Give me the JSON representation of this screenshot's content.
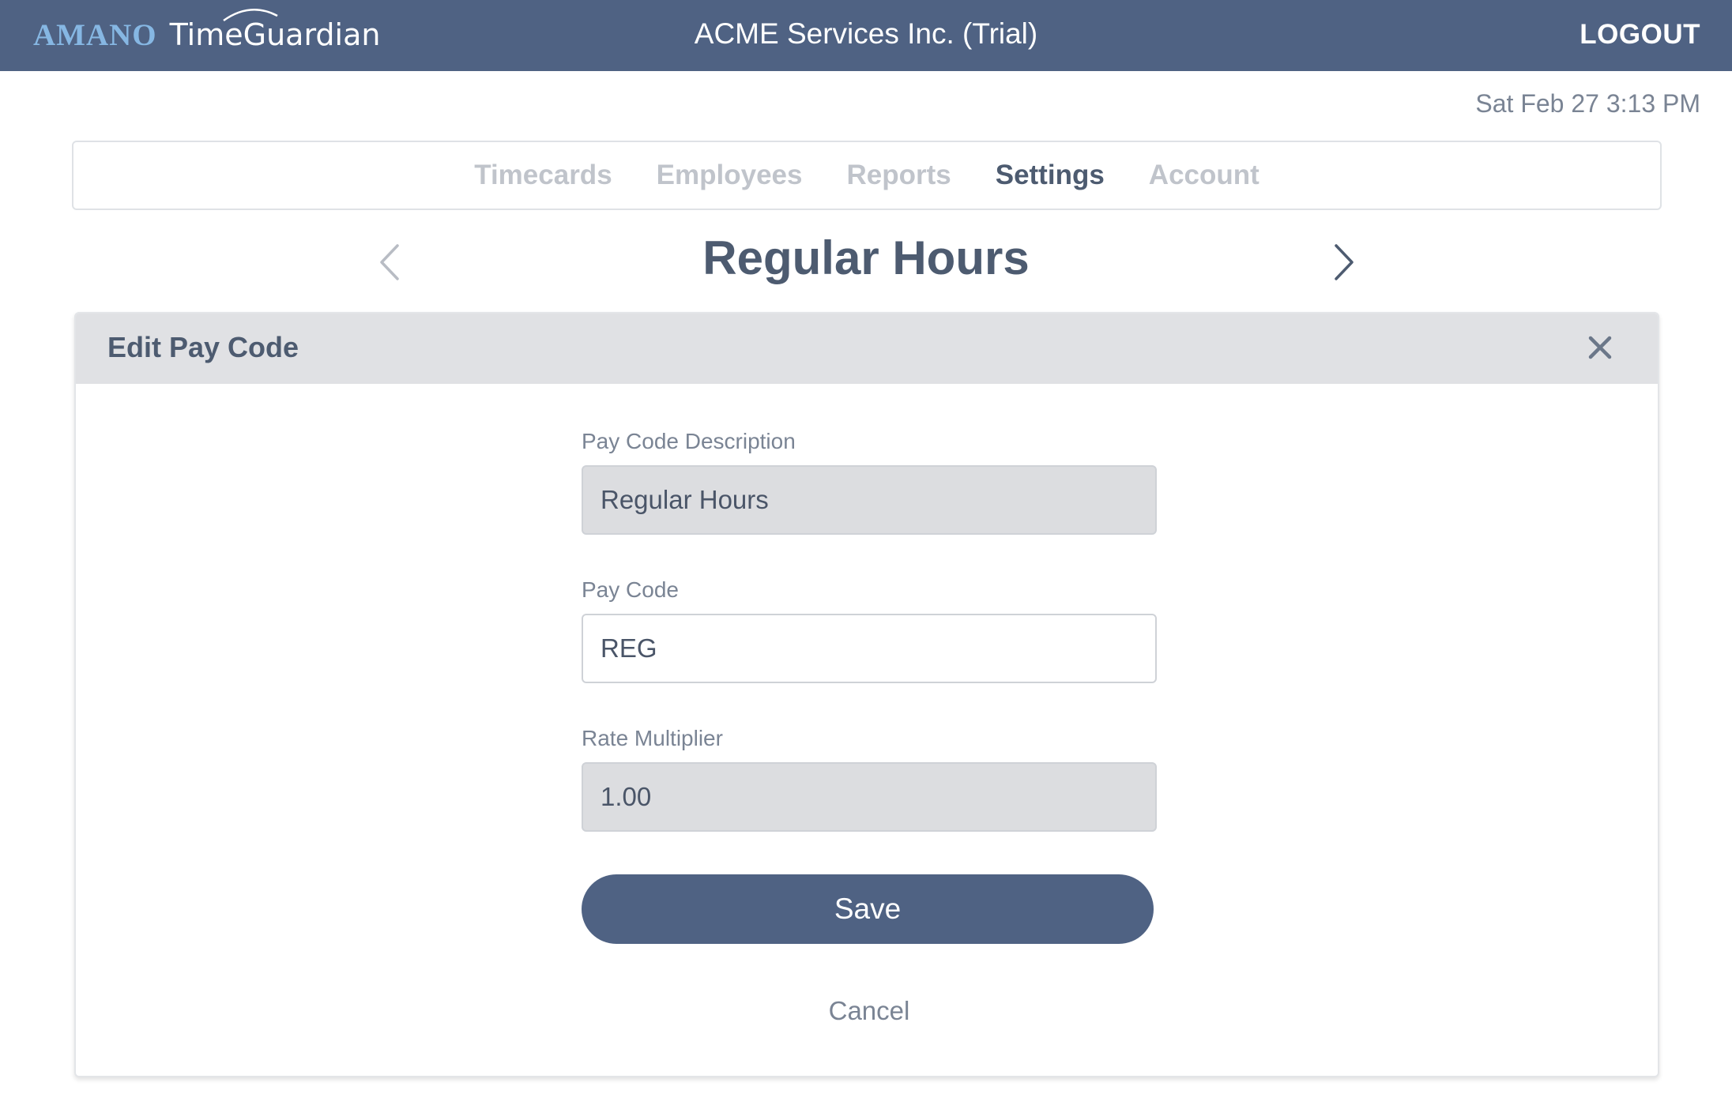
{
  "header": {
    "brand_amano": "AMANO",
    "brand_product": "TimeGuardian",
    "company": "ACME Services Inc. (Trial)",
    "logout_label": "LOGOUT"
  },
  "datetime": "Sat Feb 27 3:13 PM",
  "nav": {
    "tabs": [
      {
        "label": "Timecards",
        "active": false
      },
      {
        "label": "Employees",
        "active": false
      },
      {
        "label": "Reports",
        "active": false
      },
      {
        "label": "Settings",
        "active": true
      },
      {
        "label": "Account",
        "active": false
      }
    ]
  },
  "pager": {
    "title": "Regular Hours",
    "prev_icon": "chevron-left-icon",
    "next_icon": "chevron-right-icon"
  },
  "dialog": {
    "title": "Edit Pay Code",
    "close_icon": "close-icon",
    "fields": {
      "description": {
        "label": "Pay Code Description",
        "value": "Regular Hours",
        "readonly": true
      },
      "code": {
        "label": "Pay Code",
        "value": "REG",
        "readonly": false
      },
      "multiplier": {
        "label": "Rate Multiplier",
        "value": "1.00",
        "readonly": true
      }
    },
    "save_label": "Save",
    "cancel_label": "Cancel"
  },
  "colors": {
    "header_bg": "#4f6283",
    "brand_accent": "#86b7e3",
    "active_tab": "#4d5b70",
    "inactive_tab": "#c0c4cb",
    "readonly_field_bg": "#dcdde0"
  }
}
